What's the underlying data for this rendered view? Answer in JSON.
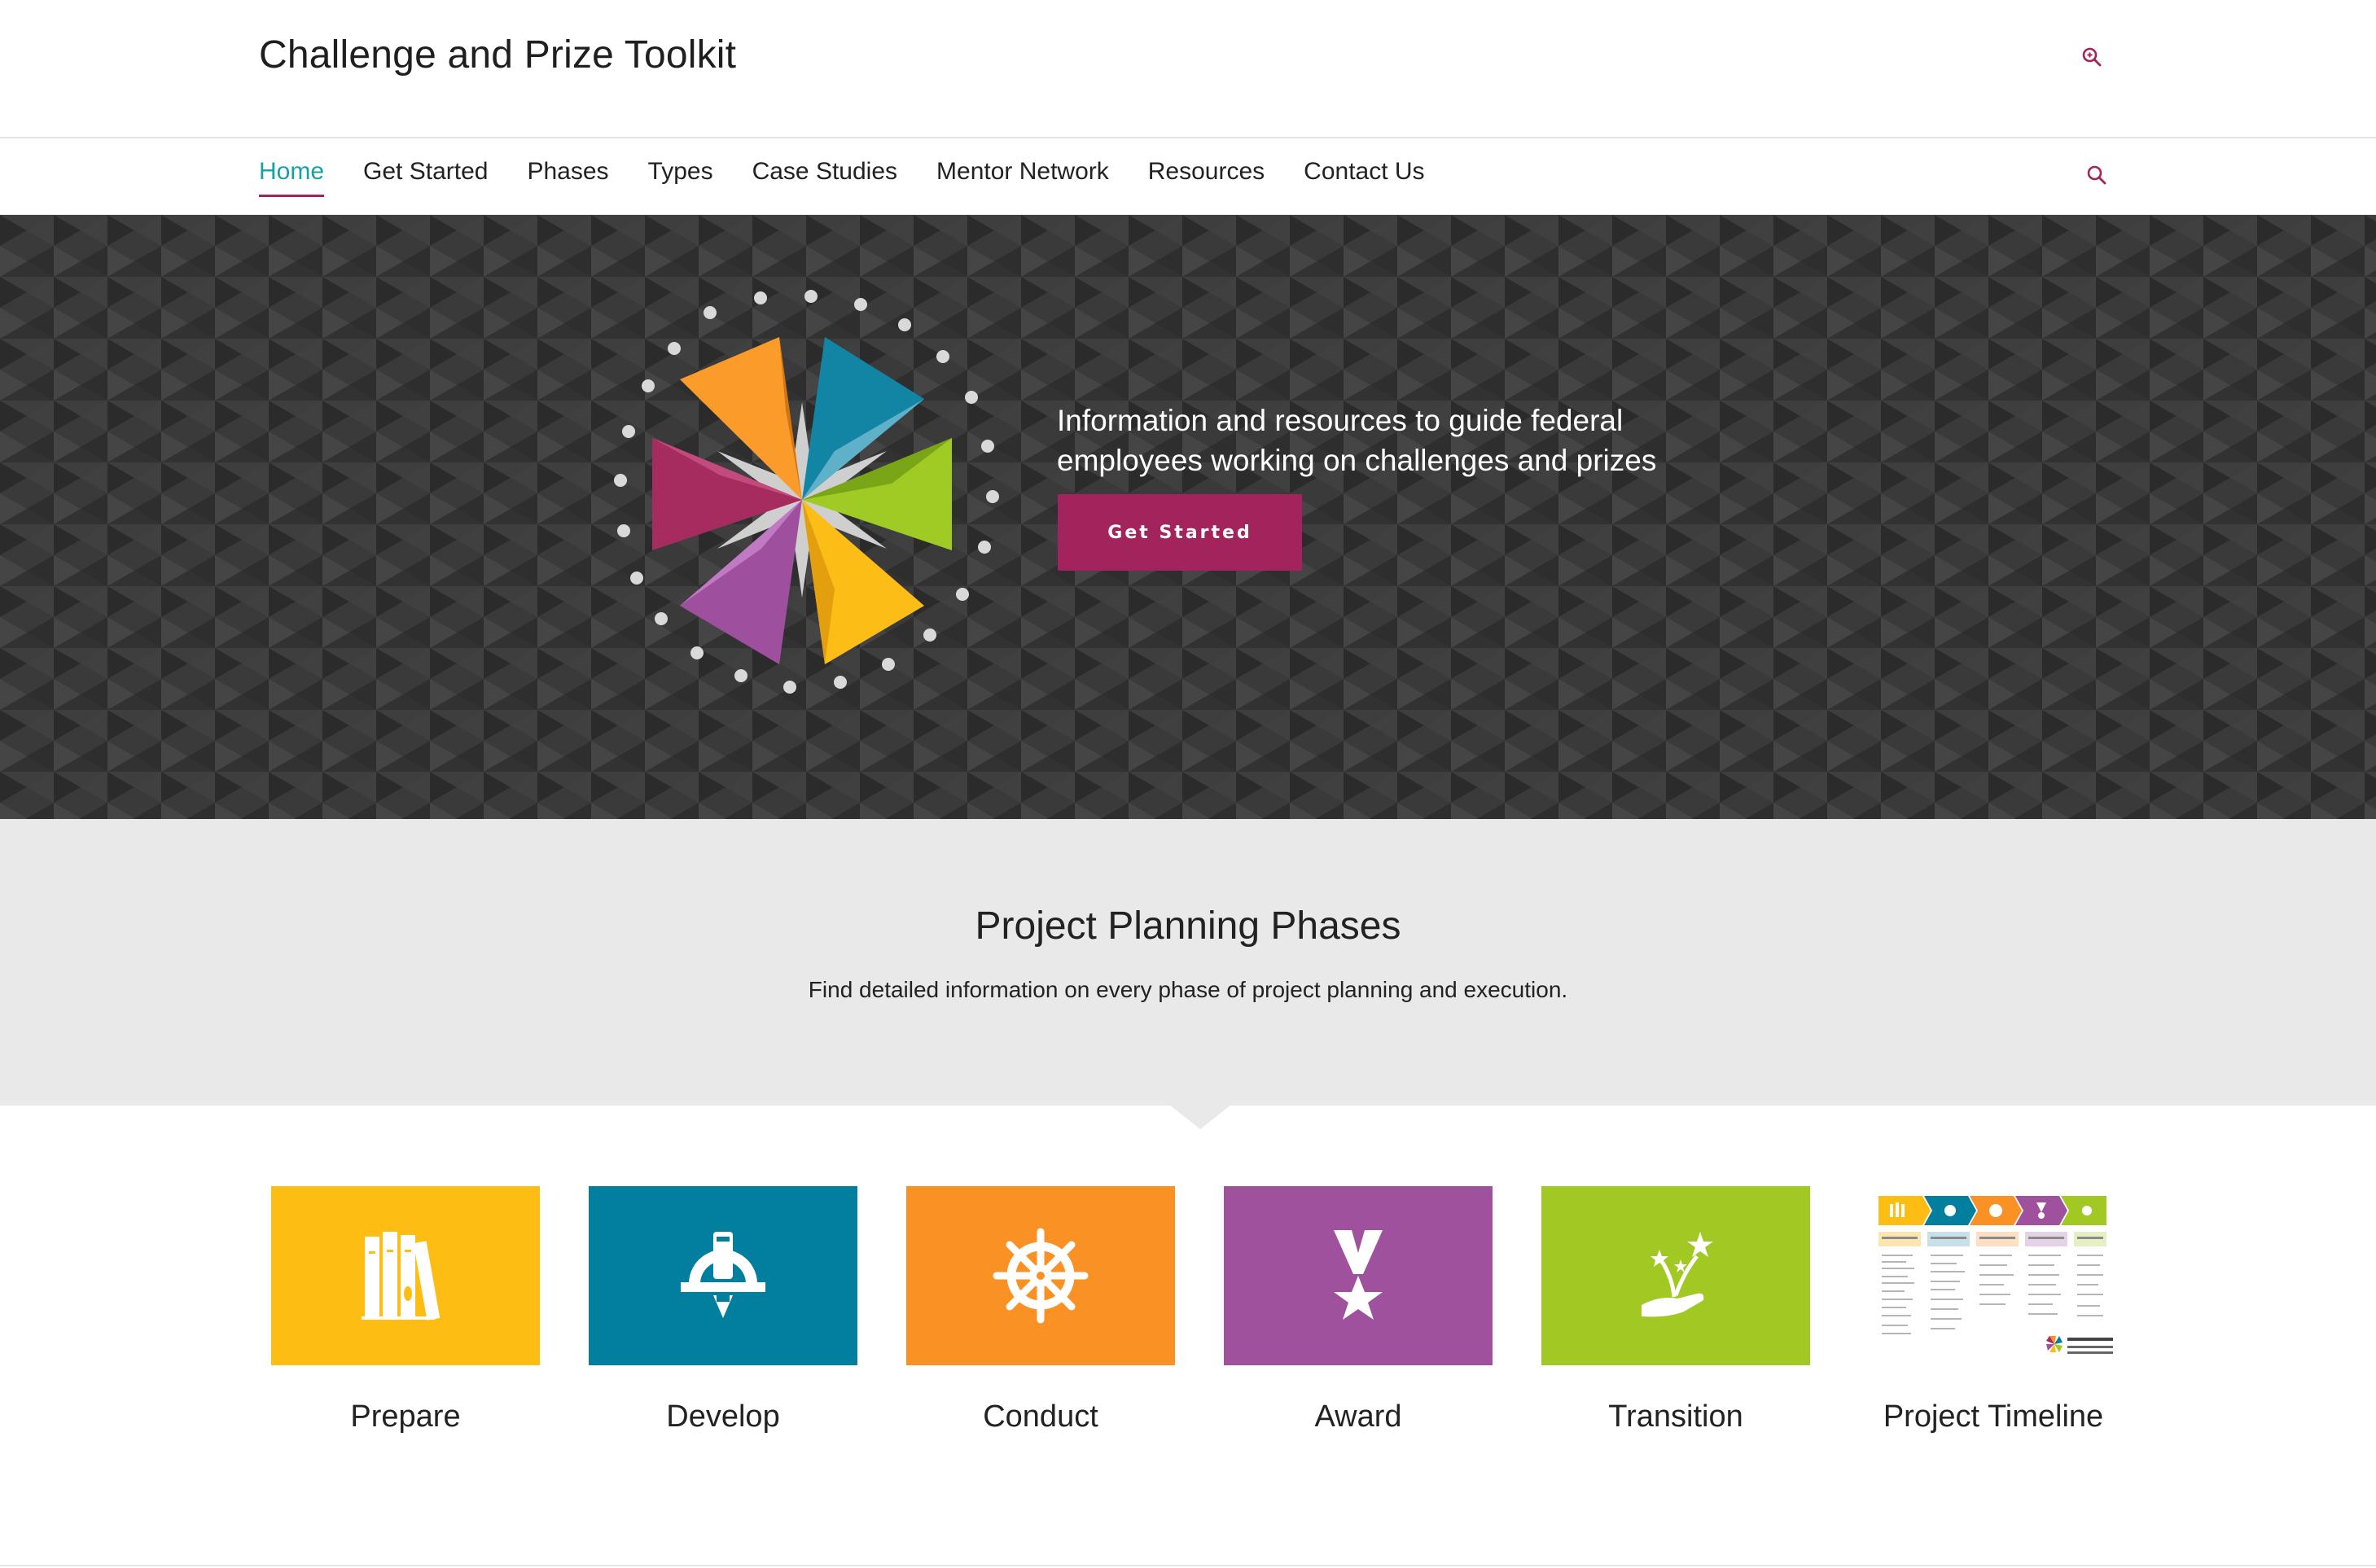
{
  "site": {
    "title": "Challenge and Prize Toolkit"
  },
  "colors": {
    "accent": "#a3245c",
    "active_nav": "#17a1a5",
    "prepare": "#fdbd12",
    "develop": "#027f9f",
    "conduct": "#fa9125",
    "award": "#9f519e",
    "transition": "#a2c923"
  },
  "nav": {
    "items": [
      {
        "label": "Home",
        "active": true
      },
      {
        "label": "Get Started"
      },
      {
        "label": "Phases"
      },
      {
        "label": "Types"
      },
      {
        "label": "Case Studies"
      },
      {
        "label": "Mentor Network"
      },
      {
        "label": "Resources"
      },
      {
        "label": "Contact Us"
      }
    ],
    "search_icon": "search-icon"
  },
  "hero": {
    "text": "Information and resources to guide federal employees working on challenges and prizes",
    "button_label": "Get Started"
  },
  "phases": {
    "title": "Project Planning Phases",
    "subtitle": "Find detailed information on every phase of project planning and execution.",
    "cards": [
      {
        "label": "Prepare",
        "icon": "books-icon",
        "color": "#fdbd12"
      },
      {
        "label": "Develop",
        "icon": "compass-pen-icon",
        "color": "#027f9f"
      },
      {
        "label": "Conduct",
        "icon": "ship-wheel-icon",
        "color": "#fa9125"
      },
      {
        "label": "Award",
        "icon": "medal-icon",
        "color": "#9f519e"
      },
      {
        "label": "Transition",
        "icon": "hand-stars-icon",
        "color": "#a2c923"
      },
      {
        "label": "Project Timeline",
        "icon": "timeline-thumbnail",
        "color": "#ffffff"
      }
    ]
  }
}
